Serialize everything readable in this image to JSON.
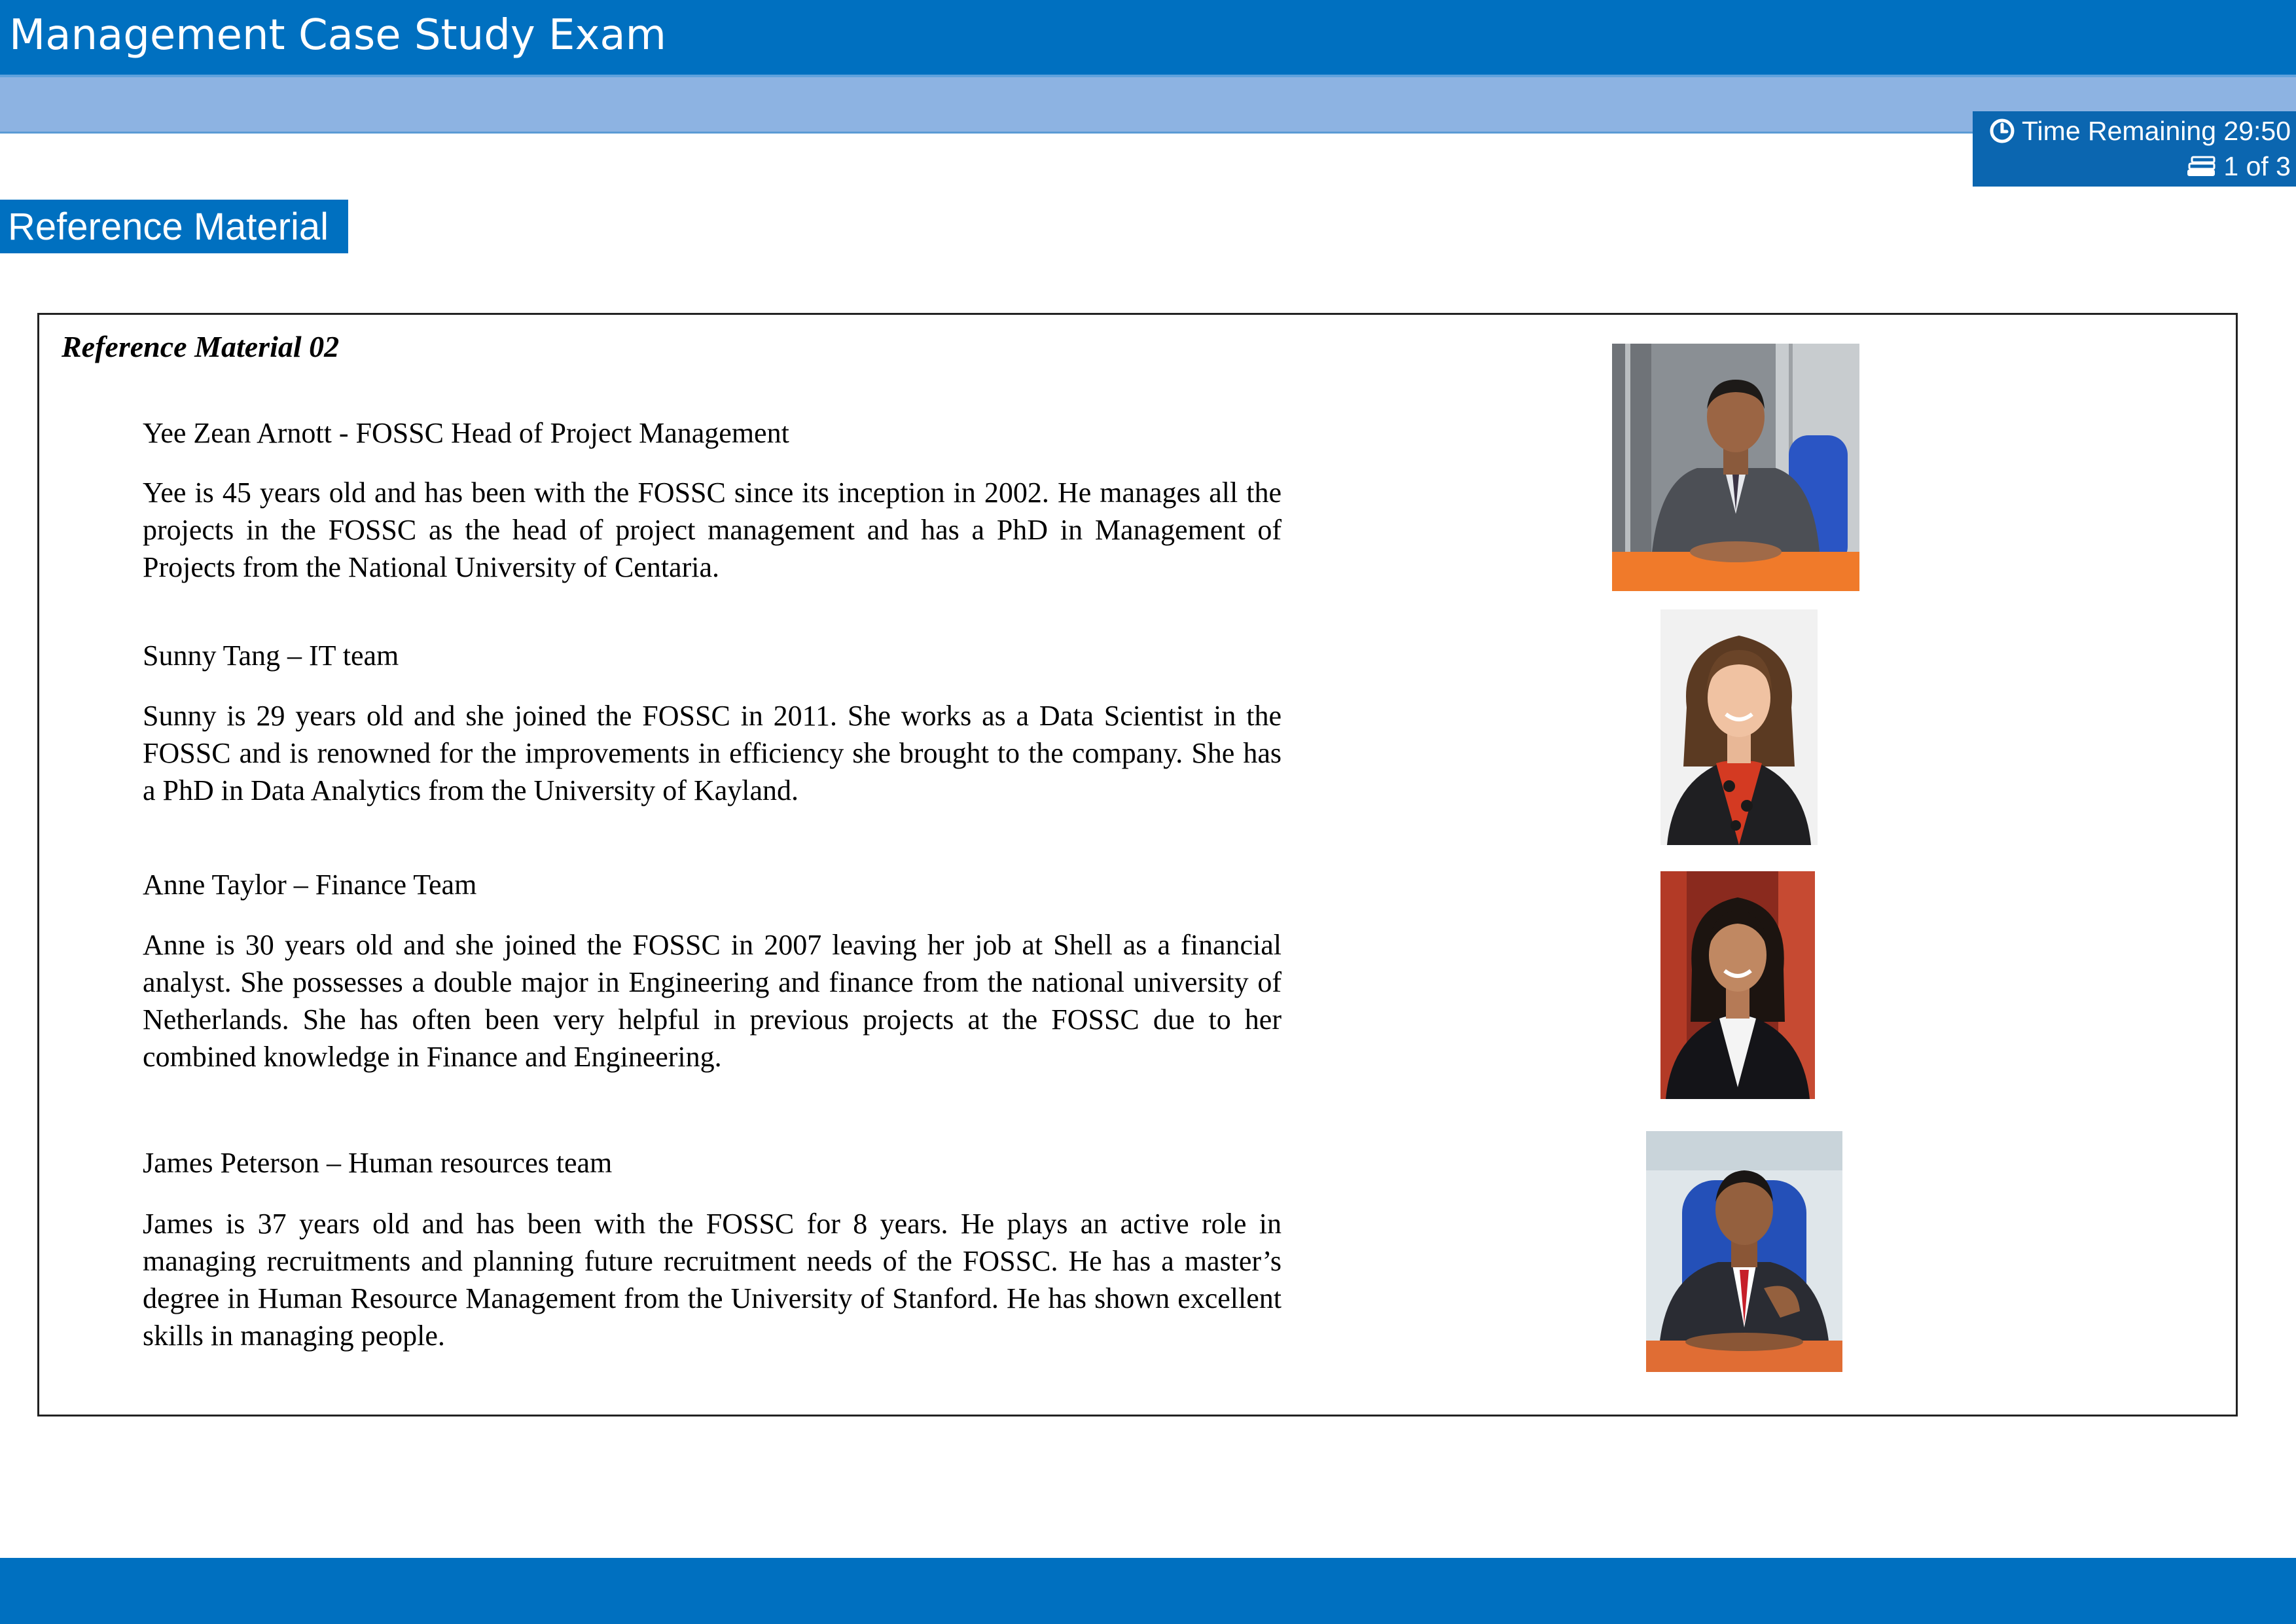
{
  "header": {
    "title": "Management Case Study Exam"
  },
  "status": {
    "time_remaining": "Time Remaining 29:50",
    "page_indicator": "1 of 3",
    "clock_icon": "clock-icon",
    "pages_icon": "pages-icon"
  },
  "reference_tab": {
    "label": "Reference Material"
  },
  "reference": {
    "heading": "Reference Material 02",
    "people": [
      {
        "name": "Yee Zean Arnott - FOSSC Head of Project Management",
        "bio": "Yee is 45 years old and has been with the FOSSC since its inception in 2002. He manages all the projects in the FOSSC as the head of project management and has a PhD in Management of Projects from the National University of Centaria."
      },
      {
        "name": "Sunny Tang – IT team",
        "bio": "Sunny is 29 years old and she joined the FOSSC in 2011. She works as a Data Scientist in the FOSSC and is renowned for the improvements in efficiency she brought to the company. She has a PhD in Data Analytics from the University of Kayland."
      },
      {
        "name": "Anne Taylor – Finance Team",
        "bio": "Anne is 30 years old and she joined the FOSSC in 2007 leaving her job at Shell as a financial analyst. She possesses a double major in Engineering and finance from the national university of Netherlands. She has often been very helpful in previous projects at the FOSSC due to her combined knowledge in Finance and Engineering."
      },
      {
        "name": "James Peterson – Human resources team",
        "bio": "James is 37 years old and has been with the FOSSC for 8 years. He plays an active role in managing recruitments and planning future recruitment needs of the FOSSC. He has a master’s degree in Human Resource Management from the University of Stanford. He has shown excellent skills in managing people."
      }
    ]
  },
  "colors": {
    "header_blue": "#0070c0",
    "subbar_blue": "#8db3e2",
    "status_blue": "#0b66b0"
  }
}
